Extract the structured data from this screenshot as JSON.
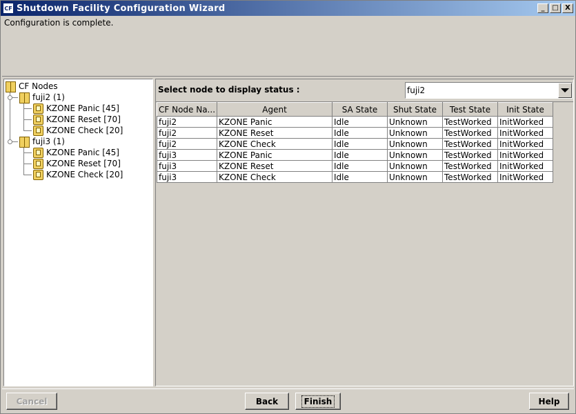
{
  "window": {
    "icon_label": "CF",
    "title": "Shutdown Facility Configuration Wizard",
    "minimize": "_",
    "maximize": "□",
    "close": "X"
  },
  "message": "Configuration is complete.",
  "tree": {
    "root": "CF Nodes",
    "nodes": [
      {
        "label": "fuji2 (1)",
        "agents": [
          "KZONE Panic [45]",
          "KZONE Reset [70]",
          "KZONE Check [20]"
        ]
      },
      {
        "label": "fuji3 (1)",
        "agents": [
          "KZONE Panic [45]",
          "KZONE Reset [70]",
          "KZONE Check [20]"
        ]
      }
    ]
  },
  "status": {
    "select_label": "Select node to display status :",
    "selected_node": "fuji2"
  },
  "table": {
    "columns": [
      "CF Node Na...",
      "Agent",
      "SA State",
      "Shut State",
      "Test State",
      "Init State"
    ],
    "rows": [
      [
        "fuji2",
        "KZONE Panic",
        "Idle",
        "Unknown",
        "TestWorked",
        "InitWorked"
      ],
      [
        "fuji2",
        "KZONE Reset",
        "Idle",
        "Unknown",
        "TestWorked",
        "InitWorked"
      ],
      [
        "fuji2",
        "KZONE Check",
        "Idle",
        "Unknown",
        "TestWorked",
        "InitWorked"
      ],
      [
        "fuji3",
        "KZONE Panic",
        "Idle",
        "Unknown",
        "TestWorked",
        "InitWorked"
      ],
      [
        "fuji3",
        "KZONE Reset",
        "Idle",
        "Unknown",
        "TestWorked",
        "InitWorked"
      ],
      [
        "fuji3",
        "KZONE Check",
        "Idle",
        "Unknown",
        "TestWorked",
        "InitWorked"
      ]
    ]
  },
  "buttons": {
    "cancel": "Cancel",
    "back": "Back",
    "finish": "Finish",
    "help": "Help"
  },
  "colors": {
    "titlebar_start": "#0a246a",
    "titlebar_end": "#a6caf0",
    "window_bg": "#d4d0c8"
  }
}
